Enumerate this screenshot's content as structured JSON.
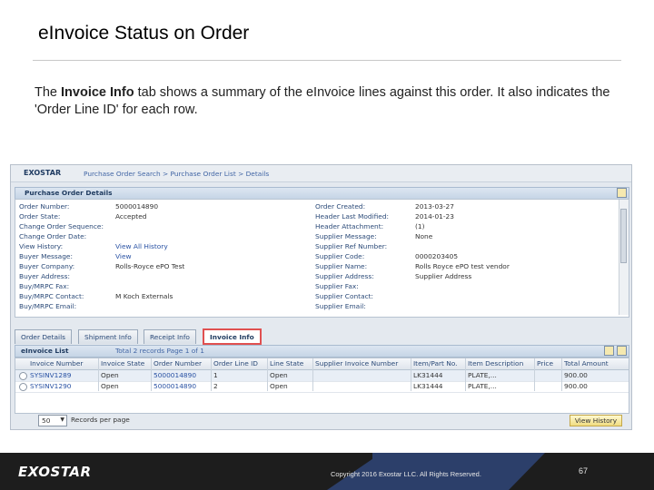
{
  "slide": {
    "title": "eInvoice Status on Order",
    "body_pre": "The ",
    "body_bold": "Invoice Info",
    "body_post": " tab shows a summary of the eInvoice lines against this order.  It also indicates the 'Order Line ID' for each row."
  },
  "app": {
    "logo": "EXOSTAR",
    "breadcrumb": "Purchase Order Search > Purchase Order List > Details",
    "panel_title": "Purchase Order Details",
    "details_left": [
      {
        "label": "Order Number:",
        "value": "5000014890"
      },
      {
        "label": "Order State:",
        "value": "Accepted"
      },
      {
        "label": "Change Order Sequence:",
        "value": ""
      },
      {
        "label": "Change Order Date:",
        "value": ""
      },
      {
        "label": "View History:",
        "value": "View All History"
      },
      {
        "label": "Buyer Message:",
        "value": "View"
      },
      {
        "label": "Buyer Company:",
        "value": "Rolls-Royce ePO Test"
      },
      {
        "label": "Buyer Address:",
        "value": ""
      },
      {
        "label": "Buy/MRPC Fax:",
        "value": ""
      },
      {
        "label": "Buy/MRPC Contact:",
        "value": "M Koch Externals"
      },
      {
        "label": "Buy/MRPC Email:",
        "value": ""
      }
    ],
    "details_right": [
      {
        "label": "Order Created:",
        "value": "2013-03-27"
      },
      {
        "label": "Header Last Modified:",
        "value": "2014-01-23"
      },
      {
        "label": "Header Attachment:",
        "value": "(1)"
      },
      {
        "label": "Supplier Message:",
        "value": "None"
      },
      {
        "label": "Supplier Ref Number:",
        "value": ""
      },
      {
        "label": "Supplier Code:",
        "value": "0000203405"
      },
      {
        "label": "Supplier Name:",
        "value": "Rolls Royce ePO test vendor"
      },
      {
        "label": "Supplier Address:",
        "value": "Supplier Address"
      },
      {
        "label": "Supplier Fax:",
        "value": ""
      },
      {
        "label": "Supplier Contact:",
        "value": ""
      },
      {
        "label": "Supplier Email:",
        "value": ""
      }
    ],
    "tabs": [
      "Order Details",
      "Shipment Info",
      "Receipt Info",
      "Invoice Info"
    ],
    "active_tab": "Invoice Info",
    "list_title": "eInvoice List",
    "list_paging": "Total 2 records Page 1 of 1",
    "columns": [
      "Invoice Number",
      "Invoice State",
      "Order Number",
      "Order Line ID",
      "Line State",
      "Supplier Invoice Number",
      "Item/Part No.",
      "Item Description",
      "Price",
      "Total Amount"
    ],
    "rows": [
      [
        "SYSINV1289",
        "Open",
        "5000014890",
        "1",
        "Open",
        "",
        "LK31444",
        "PLATE,...",
        "",
        "900.00"
      ],
      [
        "SYSINV1290",
        "Open",
        "5000014890",
        "2",
        "Open",
        "",
        "LK31444",
        "PLATE,...",
        "",
        "900.00"
      ]
    ],
    "records_per_page_value": "50",
    "records_per_page_label": "Records per page",
    "view_history_button": "View History"
  },
  "footer": {
    "logo": "EXOSTAR",
    "copyright": "Copyright 2016 Exostar LLC. All Rights Reserved.",
    "page_number": "67"
  },
  "colors": {
    "accent_red": "#e5232e",
    "footer_blue": "#2c3f6a",
    "link_blue": "#2851a3"
  }
}
